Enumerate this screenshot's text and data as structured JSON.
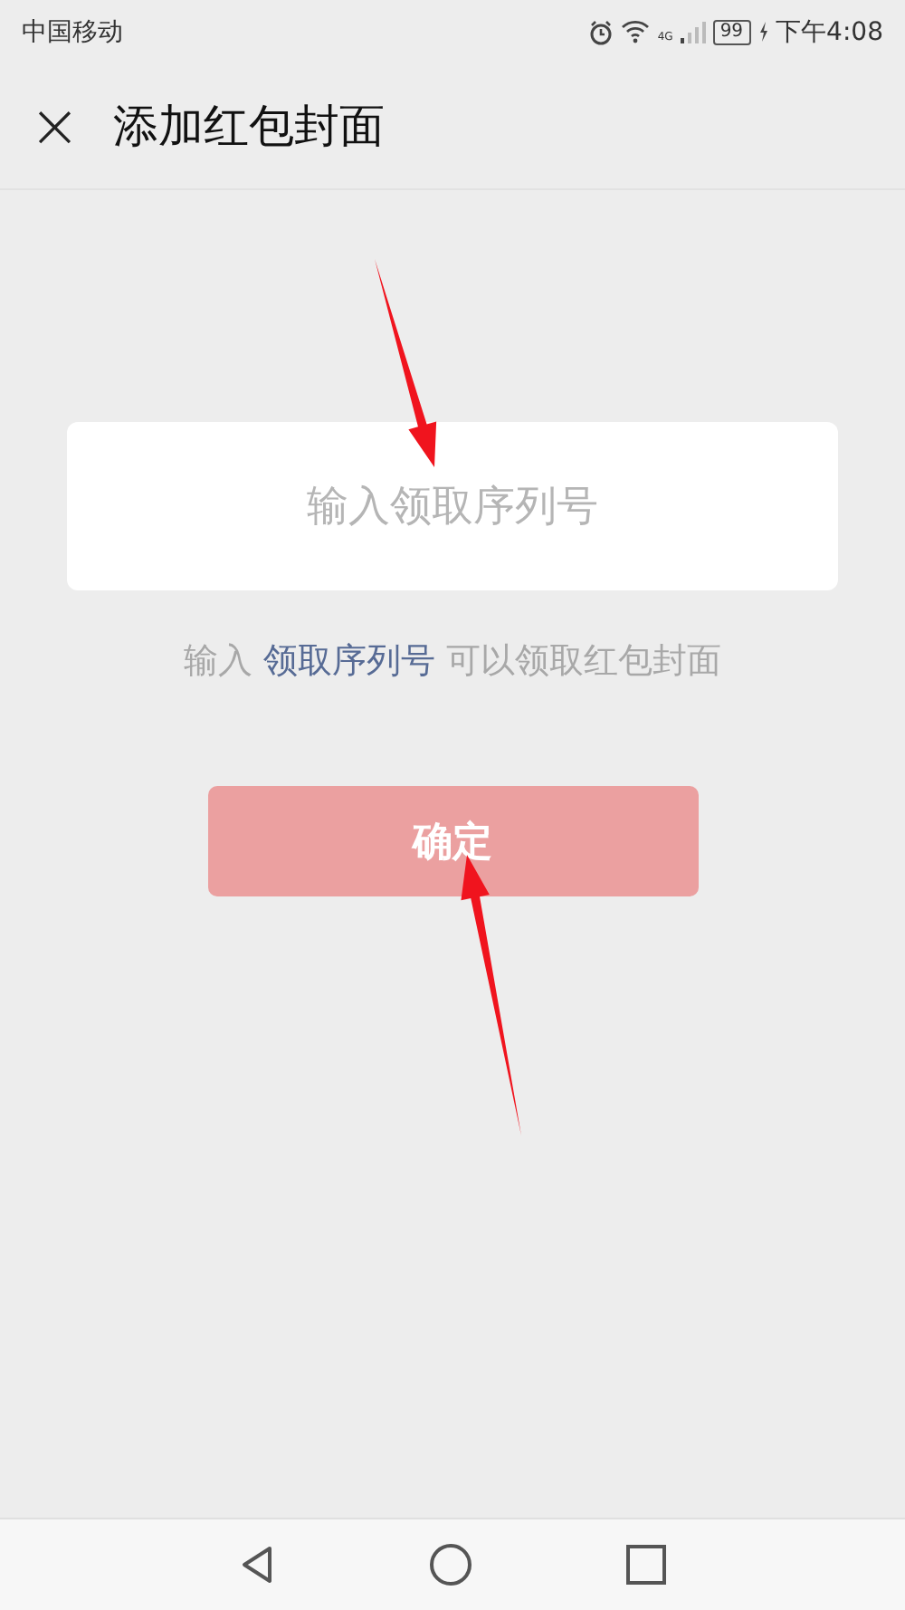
{
  "status_bar": {
    "carrier": "中国移动",
    "network": "4G",
    "battery": "99",
    "time": "下午4:08"
  },
  "title_bar": {
    "close_icon": "×",
    "title": "添加红包封面"
  },
  "field": {
    "placeholder": "输入领取序列号"
  },
  "hint": {
    "before": "输入",
    "link": "领取序列号",
    "after": "可以领取红包封面"
  },
  "button": {
    "label": "确定",
    "disabled": true
  },
  "annotations": [
    {
      "kind": "arrow"
    },
    {
      "kind": "arrow"
    }
  ]
}
